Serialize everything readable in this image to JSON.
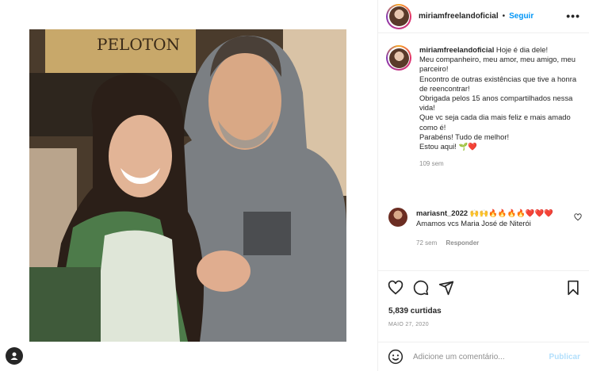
{
  "post": {
    "username": "miriamfreelandoficial",
    "follow_label": "Seguir",
    "more_label": "•••",
    "caption_lines": [
      "Hoje é dia dele!",
      "Meu companheiro, meu amor, meu amigo, meu parceiro!",
      "Encontro de outras existências que tive a honra de reencontrar!",
      "Obrigada pelos 15 anos compartilhados nessa vida!",
      "Que vc seja cada dia mais feliz e mais amado como é!",
      "Parabéns! Tudo de melhor!",
      "Estou aqui! 🌱❤️"
    ],
    "caption_time": "109 sem",
    "likes": "5,839 curtidas",
    "date": "MAIO 27, 2020"
  },
  "comment": {
    "username": "mariasnt_2022",
    "emojis": "🙌🙌🔥🔥🔥🔥❤️❤️❤️",
    "text": "Amamos vcs Maria José de Niterói",
    "time": "72 sem",
    "reply_label": "Responder"
  },
  "add_comment": {
    "placeholder": "Adicione um comentário...",
    "publish_label": "Publicar"
  },
  "photo": {
    "sign_text": "PELOTON"
  },
  "colors": {
    "link_blue": "#0095f6",
    "publish_disabled": "#b2dffc",
    "muted": "#8e8e8e",
    "border": "#efefef"
  },
  "icons": [
    "heart-icon",
    "comment-icon",
    "share-icon",
    "bookmark-icon",
    "emoji-icon",
    "user-icon",
    "more-icon"
  ]
}
